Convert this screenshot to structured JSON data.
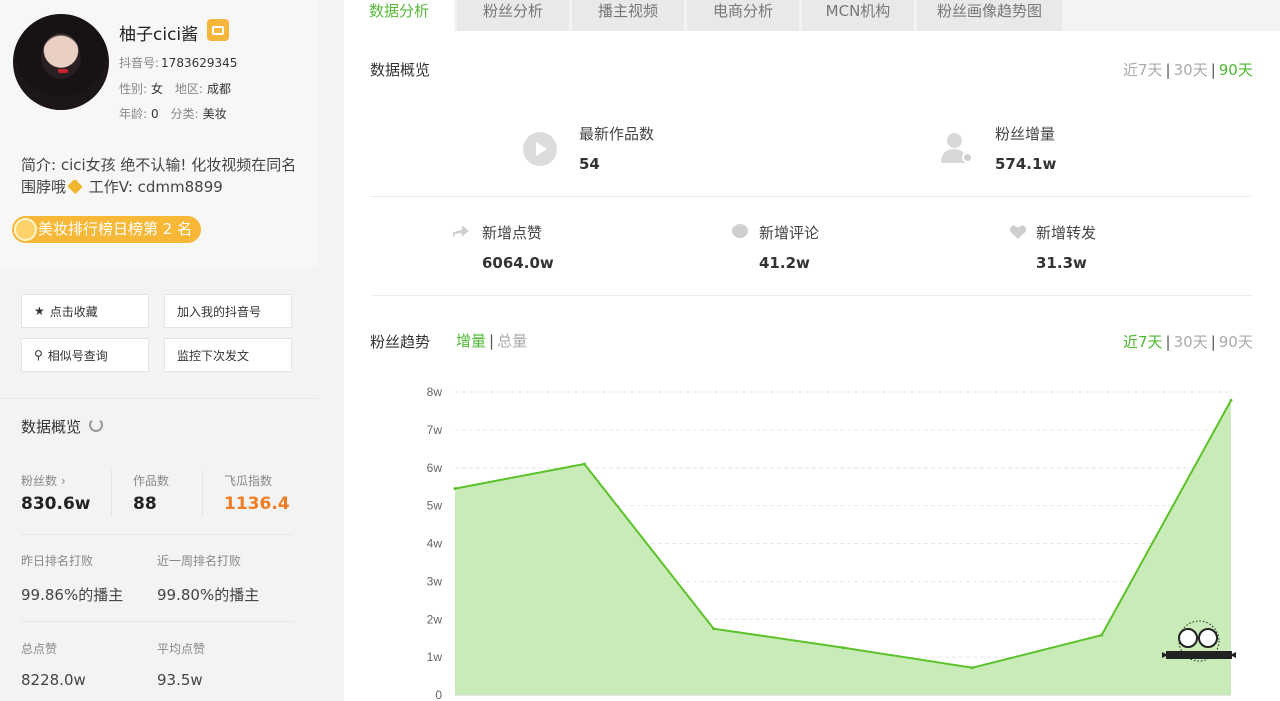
{
  "profile": {
    "name": "柚子cici酱",
    "douyin_label": "抖音号:",
    "douyin_id": "1783629345",
    "gender_label": "性别:",
    "gender": "女",
    "region_label": "地区:",
    "region": "成都",
    "age_label": "年龄:",
    "age": "0",
    "category_label": "分类:",
    "category": "美妆",
    "intro_line1": "简介: cici女孩 绝不认输!  化妆视频在同名",
    "intro_line2a": "围脖哦",
    "intro_line2b": " 工作V: cdmm8899",
    "rank_text": "美妆排行榜日榜第 2 名"
  },
  "actions": {
    "favorite": "点击收藏",
    "add_mine": "加入我的抖音号",
    "similar": "相似号查询",
    "monitor": "监控下次发文"
  },
  "side_overview": {
    "title": "数据概览",
    "fans_label": "粉丝数",
    "fans_value": "830.6w",
    "works_label": "作品数",
    "works_value": "88",
    "feigua_label": "飞瓜指数",
    "feigua_value": "1136.4",
    "yday_rank_label": "昨日排名打败",
    "yday_rank_value": "99.86%的播主",
    "week_rank_label": "近一周排名打败",
    "week_rank_value": "99.80%的播主",
    "total_likes_label": "总点赞",
    "total_likes_value": "8228.0w",
    "avg_likes_label": "平均点赞",
    "avg_likes_value": "93.5w"
  },
  "tabs": [
    "数据分析",
    "粉丝分析",
    "播主视频",
    "电商分析",
    "MCN机构",
    "粉丝画像趋势图"
  ],
  "overview": {
    "title": "数据概览",
    "range": [
      "近7天",
      "30天",
      "90天"
    ],
    "range_active": "90天",
    "latest_works_label": "最新作品数",
    "latest_works_value": "54",
    "fans_growth_label": "粉丝增量",
    "fans_growth_value": "574.1w",
    "new_likes_label": "新增点赞",
    "new_likes_value": "6064.0w",
    "new_comments_label": "新增评论",
    "new_comments_value": "41.2w",
    "new_shares_label": "新增转发",
    "new_shares_value": "31.3w"
  },
  "trend": {
    "title": "粉丝趋势",
    "mode": [
      "增量",
      "总量"
    ],
    "mode_active": "增量",
    "range": [
      "近7天",
      "30天",
      "90天"
    ],
    "range_active": "近7天"
  },
  "colors": {
    "accent_green": "#4fb832",
    "line_green": "#5cc22b",
    "area_green": "#c8ebb8",
    "orange": "#f07d23",
    "badge_yellow": "#f6b836"
  },
  "chart_data": {
    "type": "area",
    "yticks": [
      "0",
      "1w",
      "2w",
      "3w",
      "4w",
      "5w",
      "6w",
      "7w",
      "8w"
    ],
    "ylim": [
      0,
      8
    ],
    "values": [
      5.45,
      6.1,
      1.75,
      1.25,
      0.72,
      1.58,
      7.78
    ]
  }
}
